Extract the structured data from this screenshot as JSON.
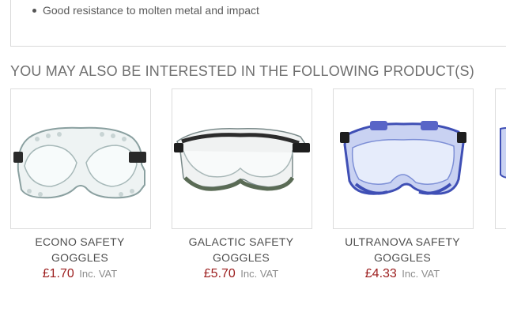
{
  "description": {
    "bullets": [
      "Good resistance to molten metal and impact"
    ]
  },
  "related": {
    "heading": "YOU MAY ALSO BE INTERESTED IN THE FOLLOWING PRODUCT(S)",
    "products": [
      {
        "name": "ECONO SAFETY GOGGLES",
        "price": "£1.70",
        "vat": "Inc. VAT",
        "image": "clear-goggles-icon"
      },
      {
        "name": "GALACTIC SAFETY GOGGLES",
        "price": "£5.70",
        "vat": "Inc. VAT",
        "image": "galactic-goggles-icon"
      },
      {
        "name": "ULTRANOVA SAFETY GOGGLES",
        "price": "£4.33",
        "vat": "Inc. VAT",
        "image": "blue-goggles-icon"
      }
    ]
  },
  "colors": {
    "price": "#9b1c1c",
    "border": "#dcdcdc",
    "blue_goggle": "#3f4fb5"
  }
}
